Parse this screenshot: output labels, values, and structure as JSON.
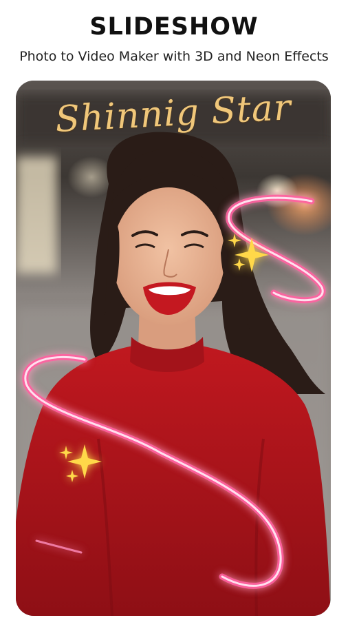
{
  "header": {
    "title": "SLIDESHOW",
    "subtitle": "Photo to Video Maker with 3D and Neon Effects"
  },
  "preview": {
    "overlay_text": "Shinnig Star",
    "photo_subject": "smiling woman in red sweater",
    "effects": [
      "neon-ribbon",
      "sparkle-icon"
    ]
  },
  "colors": {
    "neon_pink": "#ff5fa0",
    "text_gold": "#f0c77a",
    "sparkle_gold": "#ffd84a",
    "sweater_red": "#b1141c"
  }
}
